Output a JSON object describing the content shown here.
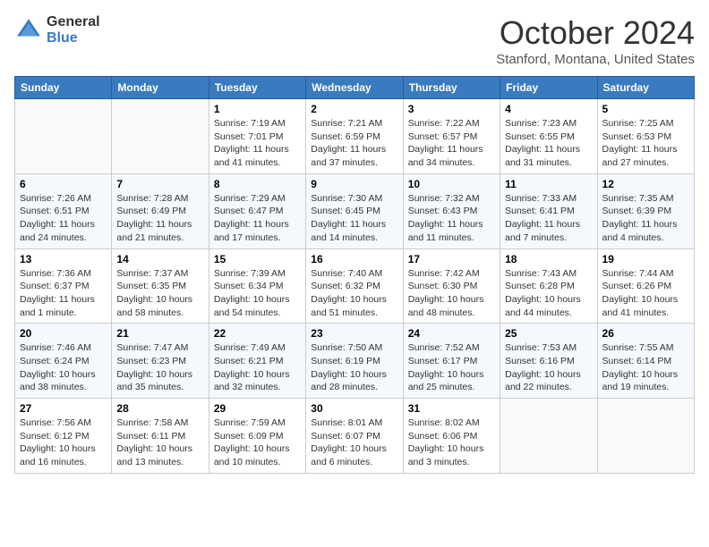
{
  "header": {
    "logo_general": "General",
    "logo_blue": "Blue",
    "title": "October 2024",
    "location": "Stanford, Montana, United States"
  },
  "days_of_week": [
    "Sunday",
    "Monday",
    "Tuesday",
    "Wednesday",
    "Thursday",
    "Friday",
    "Saturday"
  ],
  "weeks": [
    [
      {
        "day": "",
        "info": ""
      },
      {
        "day": "",
        "info": ""
      },
      {
        "day": "1",
        "sunrise": "7:19 AM",
        "sunset": "7:01 PM",
        "daylight": "11 hours and 41 minutes."
      },
      {
        "day": "2",
        "sunrise": "7:21 AM",
        "sunset": "6:59 PM",
        "daylight": "11 hours and 37 minutes."
      },
      {
        "day": "3",
        "sunrise": "7:22 AM",
        "sunset": "6:57 PM",
        "daylight": "11 hours and 34 minutes."
      },
      {
        "day": "4",
        "sunrise": "7:23 AM",
        "sunset": "6:55 PM",
        "daylight": "11 hours and 31 minutes."
      },
      {
        "day": "5",
        "sunrise": "7:25 AM",
        "sunset": "6:53 PM",
        "daylight": "11 hours and 27 minutes."
      }
    ],
    [
      {
        "day": "6",
        "sunrise": "7:26 AM",
        "sunset": "6:51 PM",
        "daylight": "11 hours and 24 minutes."
      },
      {
        "day": "7",
        "sunrise": "7:28 AM",
        "sunset": "6:49 PM",
        "daylight": "11 hours and 21 minutes."
      },
      {
        "day": "8",
        "sunrise": "7:29 AM",
        "sunset": "6:47 PM",
        "daylight": "11 hours and 17 minutes."
      },
      {
        "day": "9",
        "sunrise": "7:30 AM",
        "sunset": "6:45 PM",
        "daylight": "11 hours and 14 minutes."
      },
      {
        "day": "10",
        "sunrise": "7:32 AM",
        "sunset": "6:43 PM",
        "daylight": "11 hours and 11 minutes."
      },
      {
        "day": "11",
        "sunrise": "7:33 AM",
        "sunset": "6:41 PM",
        "daylight": "11 hours and 7 minutes."
      },
      {
        "day": "12",
        "sunrise": "7:35 AM",
        "sunset": "6:39 PM",
        "daylight": "11 hours and 4 minutes."
      }
    ],
    [
      {
        "day": "13",
        "sunrise": "7:36 AM",
        "sunset": "6:37 PM",
        "daylight": "11 hours and 1 minute."
      },
      {
        "day": "14",
        "sunrise": "7:37 AM",
        "sunset": "6:35 PM",
        "daylight": "10 hours and 58 minutes."
      },
      {
        "day": "15",
        "sunrise": "7:39 AM",
        "sunset": "6:34 PM",
        "daylight": "10 hours and 54 minutes."
      },
      {
        "day": "16",
        "sunrise": "7:40 AM",
        "sunset": "6:32 PM",
        "daylight": "10 hours and 51 minutes."
      },
      {
        "day": "17",
        "sunrise": "7:42 AM",
        "sunset": "6:30 PM",
        "daylight": "10 hours and 48 minutes."
      },
      {
        "day": "18",
        "sunrise": "7:43 AM",
        "sunset": "6:28 PM",
        "daylight": "10 hours and 44 minutes."
      },
      {
        "day": "19",
        "sunrise": "7:44 AM",
        "sunset": "6:26 PM",
        "daylight": "10 hours and 41 minutes."
      }
    ],
    [
      {
        "day": "20",
        "sunrise": "7:46 AM",
        "sunset": "6:24 PM",
        "daylight": "10 hours and 38 minutes."
      },
      {
        "day": "21",
        "sunrise": "7:47 AM",
        "sunset": "6:23 PM",
        "daylight": "10 hours and 35 minutes."
      },
      {
        "day": "22",
        "sunrise": "7:49 AM",
        "sunset": "6:21 PM",
        "daylight": "10 hours and 32 minutes."
      },
      {
        "day": "23",
        "sunrise": "7:50 AM",
        "sunset": "6:19 PM",
        "daylight": "10 hours and 28 minutes."
      },
      {
        "day": "24",
        "sunrise": "7:52 AM",
        "sunset": "6:17 PM",
        "daylight": "10 hours and 25 minutes."
      },
      {
        "day": "25",
        "sunrise": "7:53 AM",
        "sunset": "6:16 PM",
        "daylight": "10 hours and 22 minutes."
      },
      {
        "day": "26",
        "sunrise": "7:55 AM",
        "sunset": "6:14 PM",
        "daylight": "10 hours and 19 minutes."
      }
    ],
    [
      {
        "day": "27",
        "sunrise": "7:56 AM",
        "sunset": "6:12 PM",
        "daylight": "10 hours and 16 minutes."
      },
      {
        "day": "28",
        "sunrise": "7:58 AM",
        "sunset": "6:11 PM",
        "daylight": "10 hours and 13 minutes."
      },
      {
        "day": "29",
        "sunrise": "7:59 AM",
        "sunset": "6:09 PM",
        "daylight": "10 hours and 10 minutes."
      },
      {
        "day": "30",
        "sunrise": "8:01 AM",
        "sunset": "6:07 PM",
        "daylight": "10 hours and 6 minutes."
      },
      {
        "day": "31",
        "sunrise": "8:02 AM",
        "sunset": "6:06 PM",
        "daylight": "10 hours and 3 minutes."
      },
      {
        "day": "",
        "info": ""
      },
      {
        "day": "",
        "info": ""
      }
    ]
  ]
}
